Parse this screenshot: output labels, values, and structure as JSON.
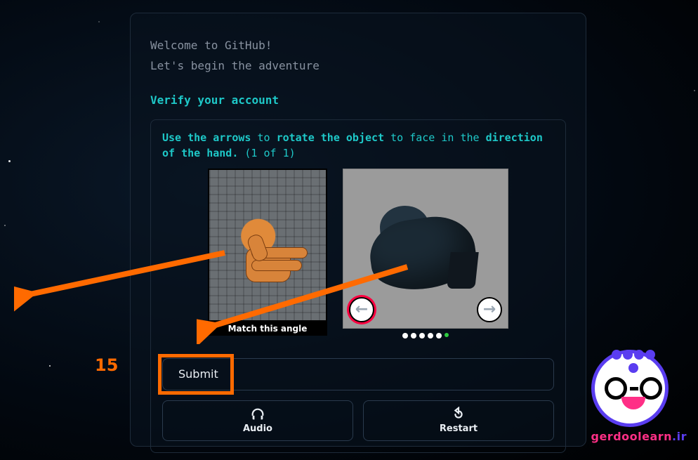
{
  "intro": {
    "line1": "Welcome to GitHub!",
    "line2": "Let's begin the adventure"
  },
  "verify_heading": "Verify your account",
  "captcha": {
    "prompt_prefix": "Use the arrows",
    "prompt_mid": " to ",
    "prompt_bold2": "rotate the object",
    "prompt_mid2": " to face in the ",
    "prompt_bold3": "direction of the hand.",
    "prompt_count": " (1 of 1)",
    "ref_caption": "Match this angle",
    "dots_total": 6,
    "dots_active_index": 5
  },
  "buttons": {
    "submit": "Submit",
    "audio": "Audio",
    "restart": "Restart"
  },
  "icons": {
    "arrow_left": "←",
    "arrow_right": "→"
  },
  "annotation": {
    "step_number": "15"
  },
  "logo": {
    "name": "gerdoolearn",
    "tld": ".ir"
  }
}
